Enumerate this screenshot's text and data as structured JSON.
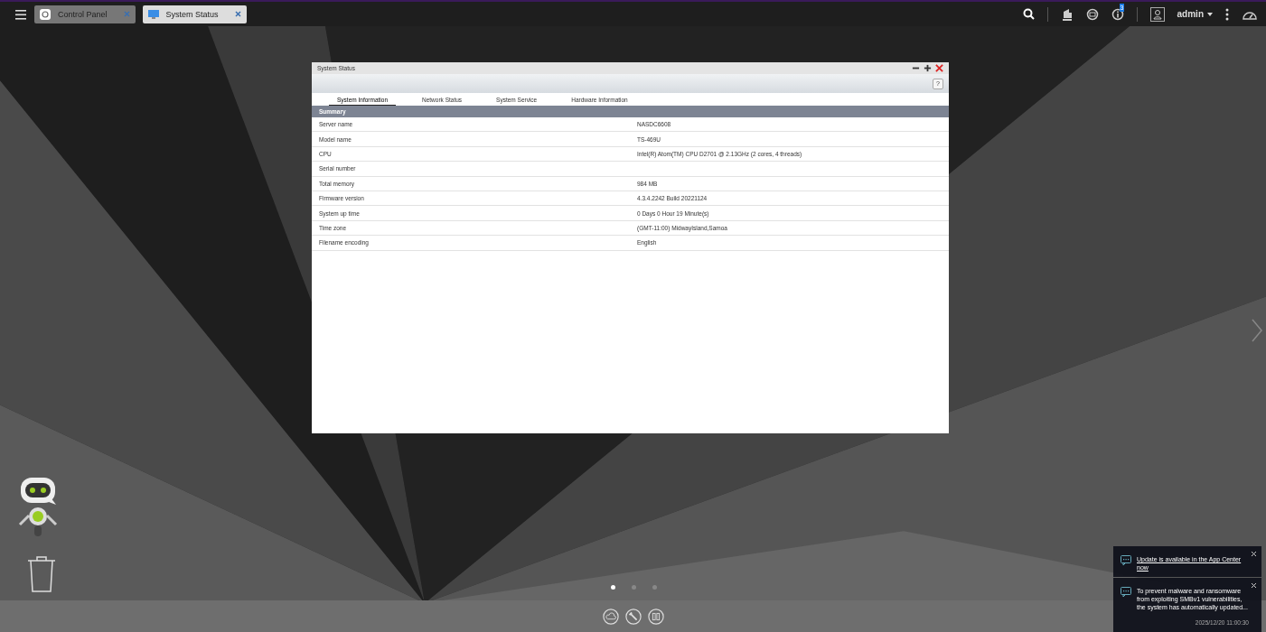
{
  "taskbar": {
    "tabs": [
      {
        "label": "Control Panel",
        "selected": false,
        "kind": "gear"
      },
      {
        "label": "System Status",
        "selected": true,
        "kind": "monitor"
      }
    ],
    "notification_count": "3",
    "user": "admin"
  },
  "window": {
    "title": "System Status",
    "tabs": [
      {
        "label": "System Information",
        "selected": true
      },
      {
        "label": "Network Status",
        "selected": false
      },
      {
        "label": "System Service",
        "selected": false
      },
      {
        "label": "Hardware Information",
        "selected": false
      }
    ],
    "help_button": "?",
    "section": "Summary",
    "rows": [
      {
        "label": "Server name",
        "value": "NASDC6608"
      },
      {
        "label": "Model name",
        "value": "TS-469U"
      },
      {
        "label": "CPU",
        "value": "Intel(R) Atom(TM) CPU D2701 @ 2.13GHz (2 cores, 4 threads)"
      },
      {
        "label": "Serial number",
        "value": ""
      },
      {
        "label": "Total memory",
        "value": "984 MB"
      },
      {
        "label": "Firmware version",
        "value": "4.3.4.2242 Build 20221124"
      },
      {
        "label": "System up time",
        "value": "0 Days 0 Hour 19 Minute(s)"
      },
      {
        "label": "Time zone",
        "value": "(GMT-11:00) MidwayIsland,Samoa"
      },
      {
        "label": "Filename encoding",
        "value": "English"
      }
    ]
  },
  "pages": [
    {
      "selected": true
    },
    {
      "selected": false
    },
    {
      "selected": false
    }
  ],
  "notifications": [
    {
      "text": "Update is available in the App Center now",
      "link": true
    },
    {
      "text": "To prevent malware and ransomware from exploiting SMBv1 vulnerabilities, the system has automatically updated...",
      "link": false,
      "time": "2025/12/20 11:00:30"
    }
  ]
}
